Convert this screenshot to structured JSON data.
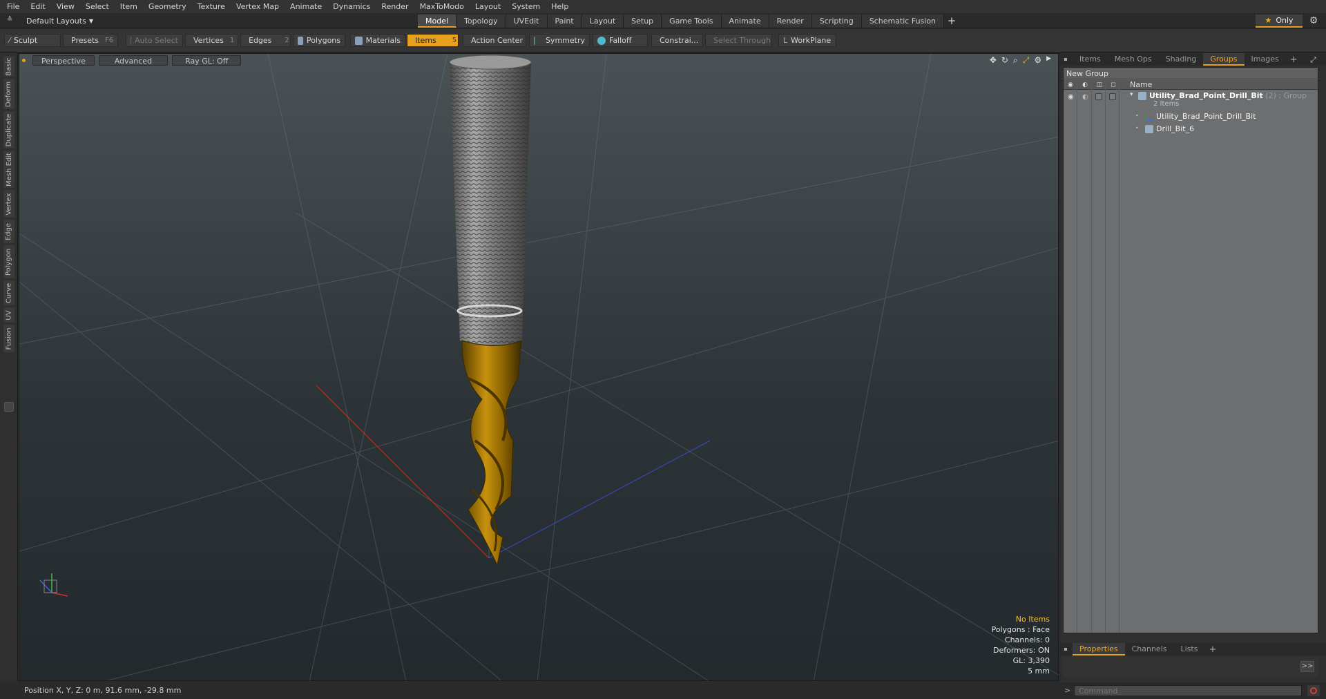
{
  "menu": [
    "File",
    "Edit",
    "View",
    "Select",
    "Item",
    "Geometry",
    "Texture",
    "Vertex Map",
    "Animate",
    "Dynamics",
    "Render",
    "MaxToModo",
    "Layout",
    "System",
    "Help"
  ],
  "layout_selector": "Default Layouts",
  "layout_tabs": [
    {
      "label": "Model",
      "active": true
    },
    {
      "label": "Topology"
    },
    {
      "label": "UVEdit"
    },
    {
      "label": "Paint"
    },
    {
      "label": "Layout"
    },
    {
      "label": "Setup"
    },
    {
      "label": "Game Tools"
    },
    {
      "label": "Animate"
    },
    {
      "label": "Render"
    },
    {
      "label": "Scripting"
    },
    {
      "label": "Schematic Fusion"
    }
  ],
  "only_label": "Only",
  "toolbar": {
    "sculpt": "Sculpt",
    "presets": "Presets",
    "presets_key": "F6",
    "auto_select": "Auto Select",
    "vertices": "Vertices",
    "vertices_count": "1",
    "edges": "Edges",
    "edges_count": "2",
    "polygons": "Polygons",
    "materials": "Materials",
    "items": "Items",
    "items_count": "5",
    "action_center": "Action Center",
    "symmetry": "Symmetry",
    "falloff": "Falloff",
    "constrain": "Constrai...",
    "select_through": "Select Through",
    "workplane": "WorkPlane"
  },
  "left_tabs": [
    "Basic",
    "Deform",
    "Duplicate",
    "Mesh Edit",
    "Vertex",
    "Edge",
    "Polygon",
    "Curve",
    "UV",
    "Fusion"
  ],
  "viewport": {
    "view": "Perspective",
    "mode": "Advanced",
    "raygl": "Ray GL: Off",
    "info": {
      "selection": "No Items",
      "polygons": "Polygons : Face",
      "channels": "Channels: 0",
      "deformers": "Deformers: ON",
      "gl": "GL: 3,390",
      "scale": "5 mm"
    }
  },
  "status": "Position X, Y, Z:  0 m, 91.6 mm, -29.8 mm",
  "right_tabs": [
    {
      "label": "Items"
    },
    {
      "label": "Mesh Ops"
    },
    {
      "label": "Shading"
    },
    {
      "label": "Groups",
      "active": true
    },
    {
      "label": "Images"
    }
  ],
  "groups": {
    "new_group": "New Group",
    "col_name": "Name",
    "group_name": "Utility_Brad_Point_Drill_Bit",
    "group_meta": "(2) : Group",
    "group_count": "2 Items",
    "children": [
      "Utility_Brad_Point_Drill_Bit",
      "Drill_Bit_6"
    ]
  },
  "bottom_tabs": [
    {
      "label": "Properties",
      "active": true
    },
    {
      "label": "Channels"
    },
    {
      "label": "Lists"
    }
  ],
  "command_placeholder": "Command",
  "colors": {
    "accent": "#e8a11c",
    "drill_gold": "#b8860b",
    "shank": "#8a8a8a"
  }
}
